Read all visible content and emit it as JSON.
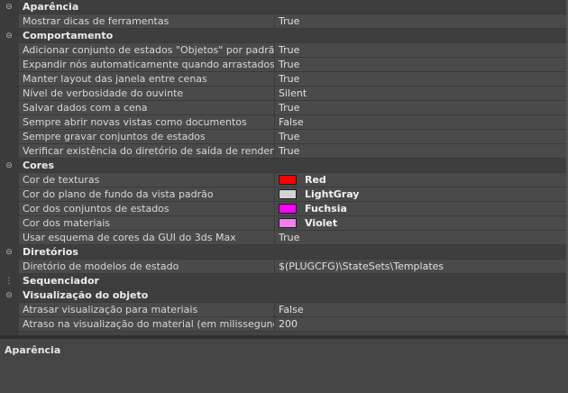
{
  "categories": [
    {
      "label": "Aparência",
      "expanded": true,
      "rows": [
        {
          "name": "Mostrar dicas de ferramentas",
          "value": "True"
        }
      ]
    },
    {
      "label": "Comportamento",
      "expanded": true,
      "rows": [
        {
          "name": "Adicionar conjunto de estados \"Objetos\" por padrão",
          "value": "True"
        },
        {
          "name": "Expandir nós automaticamente quando arrastados",
          "value": "True"
        },
        {
          "name": "Manter layout das janela entre cenas",
          "value": "True"
        },
        {
          "name": "Nível de verbosidade do ouvinte",
          "value": "Silent"
        },
        {
          "name": "Salvar dados com a cena",
          "value": "True"
        },
        {
          "name": "Sempre abrir novas vistas como documentos",
          "value": "False"
        },
        {
          "name": "Sempre gravar conjuntos de estados",
          "value": "True"
        },
        {
          "name": "Verificar existência do diretório de saída de renderização",
          "value": "True"
        }
      ]
    },
    {
      "label": "Cores",
      "expanded": true,
      "rows": [
        {
          "name": "Cor de texturas",
          "value": "Red",
          "color": "#ff0000"
        },
        {
          "name": "Cor do plano de fundo da vista padrão",
          "value": "LightGray",
          "color": "#d3d3d3"
        },
        {
          "name": "Cor dos conjuntos de estados",
          "value": "Fuchsia",
          "color": "#ff00ff"
        },
        {
          "name": "Cor dos materiais",
          "value": "Violet",
          "color": "#ee82ee"
        },
        {
          "name": "Usar esquema de cores da GUI do 3ds Max",
          "value": "True"
        }
      ]
    },
    {
      "label": "Diretórios",
      "expanded": true,
      "rows": [
        {
          "name": "Diretório de modelos de estado",
          "value": "$(PLUGCFG)\\StateSets\\Templates"
        }
      ]
    },
    {
      "label": "Sequenciador",
      "expanded": false,
      "rows": []
    },
    {
      "label": "Visualização do objeto",
      "expanded": true,
      "rows": [
        {
          "name": "Atrasar visualização para materiais",
          "value": "False"
        },
        {
          "name": "Atraso na visualização do material (em milissegundos)",
          "value": "200"
        }
      ]
    }
  ],
  "description": {
    "title": "Aparência"
  },
  "icons": {
    "expanded": "collapse-icon",
    "collapsed": "expand-icon"
  }
}
